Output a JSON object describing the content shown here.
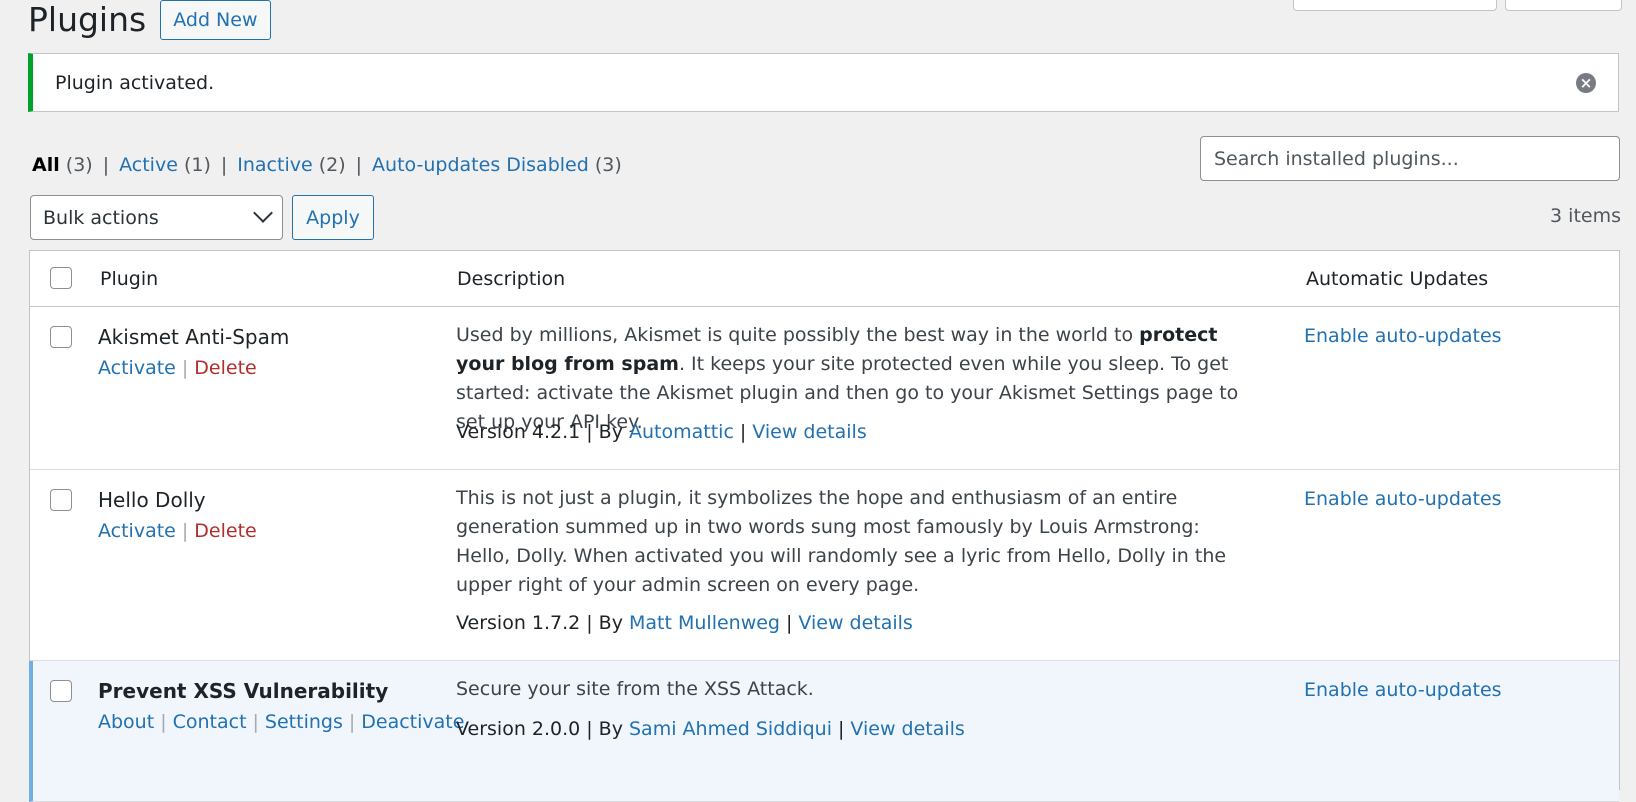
{
  "header": {
    "title": "Plugins",
    "add_new": "Add New"
  },
  "notice": {
    "text": "Plugin activated."
  },
  "filters": {
    "all": "All",
    "all_count": "(3)",
    "active": "Active",
    "active_count": "(1)",
    "inactive": "Inactive",
    "inactive_count": "(2)",
    "autoupd": "Auto-updates Disabled",
    "autoupd_count": "(3)"
  },
  "search": {
    "placeholder": "Search installed plugins..."
  },
  "bulk": {
    "label": "Bulk actions",
    "apply": "Apply"
  },
  "items_count": "3 items",
  "table": {
    "col_plugin": "Plugin",
    "col_description": "Description",
    "col_updates": "Automatic Updates"
  },
  "plugins": [
    {
      "name": "Akismet Anti-Spam",
      "actions": [
        "Activate",
        "Delete"
      ],
      "desc_pre": "Used by millions, Akismet is quite possibly the best way in the world to ",
      "desc_bold": "protect your blog from spam",
      "desc_post": ". It keeps your site protected even while you sleep. To get started: activate the Akismet plugin and then go to your Akismet Settings page to set up your API key.",
      "version": "Version 4.2.1",
      "by": "By",
      "author": "Automattic",
      "view": "View details",
      "auto": "Enable auto-updates"
    },
    {
      "name": "Hello Dolly",
      "actions": [
        "Activate",
        "Delete"
      ],
      "desc": "This is not just a plugin, it symbolizes the hope and enthusiasm of an entire generation summed up in two words sung most famously by Louis Armstrong: Hello, Dolly. When activated you will randomly see a lyric from Hello, Dolly in the upper right of your admin screen on every page.",
      "version": "Version 1.7.2",
      "by": "By",
      "author": "Matt Mullenweg",
      "view": "View details",
      "auto": "Enable auto-updates"
    },
    {
      "name": "Prevent XSS Vulnerability",
      "actions": [
        "About",
        "Contact",
        "Settings",
        "Deactivate"
      ],
      "desc": "Secure your site from the XSS Attack.",
      "version": "Version 2.0.0",
      "by": "By",
      "author": "Sami Ahmed Siddiqui",
      "view": "View details",
      "auto": "Enable auto-updates"
    }
  ]
}
